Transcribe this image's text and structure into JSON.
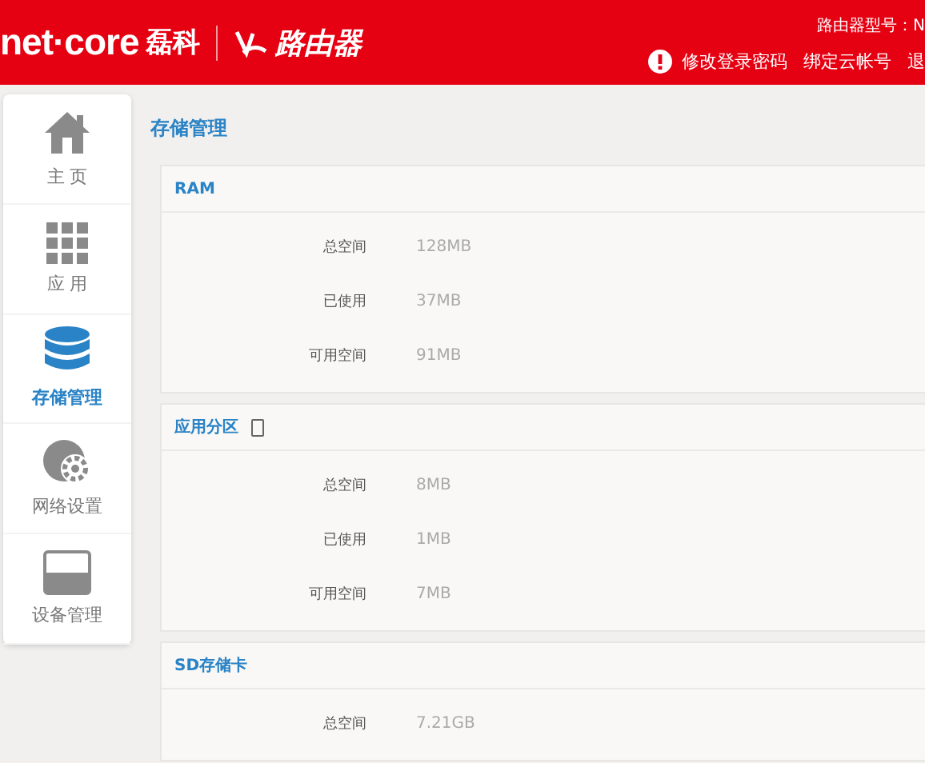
{
  "header": {
    "brand": "net·core",
    "brand_cn": "磊科",
    "product": "路由器",
    "model_label": "路由器型号：N",
    "links": [
      {
        "kind": "alert",
        "label": "修改登录密码"
      },
      {
        "kind": "plain",
        "label": "绑定云帐号"
      },
      {
        "kind": "plain",
        "label": "退"
      }
    ]
  },
  "sidebar": {
    "items": [
      {
        "kind": "home",
        "label": "主 页",
        "selected": false
      },
      {
        "kind": "apps",
        "label": "应 用",
        "selected": false
      },
      {
        "kind": "storage",
        "label": "存储管理",
        "selected": true
      },
      {
        "kind": "network",
        "label": "网络设置",
        "selected": false
      },
      {
        "kind": "device",
        "label": "设备管理",
        "selected": false
      }
    ]
  },
  "page_title": "存储管理",
  "sections": [
    {
      "title": "RAM",
      "icon": false,
      "rows": [
        {
          "label": "总空间",
          "value": "128MB"
        },
        {
          "label": "已使用",
          "value": "37MB"
        },
        {
          "label": "可用空间",
          "value": "91MB"
        }
      ]
    },
    {
      "title": "应用分区",
      "icon": true,
      "rows": [
        {
          "label": "总空间",
          "value": "8MB"
        },
        {
          "label": "已使用",
          "value": "1MB"
        },
        {
          "label": "可用空间",
          "value": "7MB"
        }
      ]
    },
    {
      "title": "SD存储卡",
      "icon": false,
      "rows": [
        {
          "label": "总空间",
          "value": "7.21GB"
        }
      ]
    }
  ]
}
